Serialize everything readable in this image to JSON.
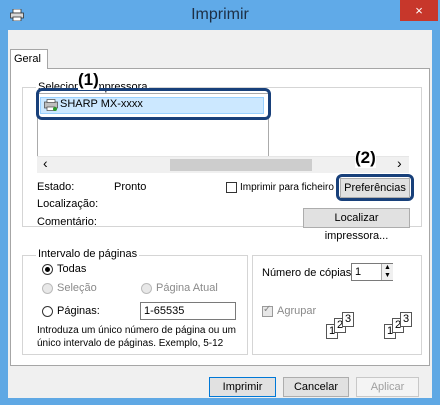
{
  "window": {
    "title": "Imprimir",
    "close_glyph": "×"
  },
  "tabs": [
    {
      "label": "Geral"
    }
  ],
  "printer_group": {
    "label": "Selecionar impressora",
    "printers": [
      {
        "name": "SHARP MX-xxxx",
        "selected": true
      }
    ]
  },
  "callouts": {
    "one": "(1)",
    "two": "(2)"
  },
  "scroll": {
    "left_arrow": "‹",
    "right_arrow": "›"
  },
  "status": {
    "estado_label": "Estado:",
    "estado_value": "Pronto",
    "localizacao_label": "Localização:",
    "localizacao_value": "",
    "comentario_label": "Comentário:",
    "comentario_value": ""
  },
  "print_to_file": {
    "label": "Imprimir para ficheiro",
    "checked": false
  },
  "buttons": {
    "preferencias": "Preferências",
    "localizar": "Localizar impressora...",
    "imprimir": "Imprimir",
    "cancelar": "Cancelar",
    "aplicar": "Aplicar"
  },
  "page_range": {
    "label": "Intervalo de páginas",
    "todas": "Todas",
    "selecao": "Seleção",
    "pagina_atual": "Página Atual",
    "paginas": "Páginas:",
    "paginas_value": "1-65535",
    "hint_line1": "Introduza um único número de página ou um",
    "hint_line2": "único intervalo de páginas. Exemplo, 5-12",
    "selected": "Todas"
  },
  "copies": {
    "label": "Número de cópias:",
    "value": "1",
    "collate_label": "Agrupar",
    "collate_checked": true,
    "page_numbers": [
      "1",
      "2",
      "3"
    ]
  },
  "colors": {
    "titlebar": "#60aae8",
    "close": "#c7372b",
    "callout": "#18407a",
    "selection": "#cce8ff"
  }
}
